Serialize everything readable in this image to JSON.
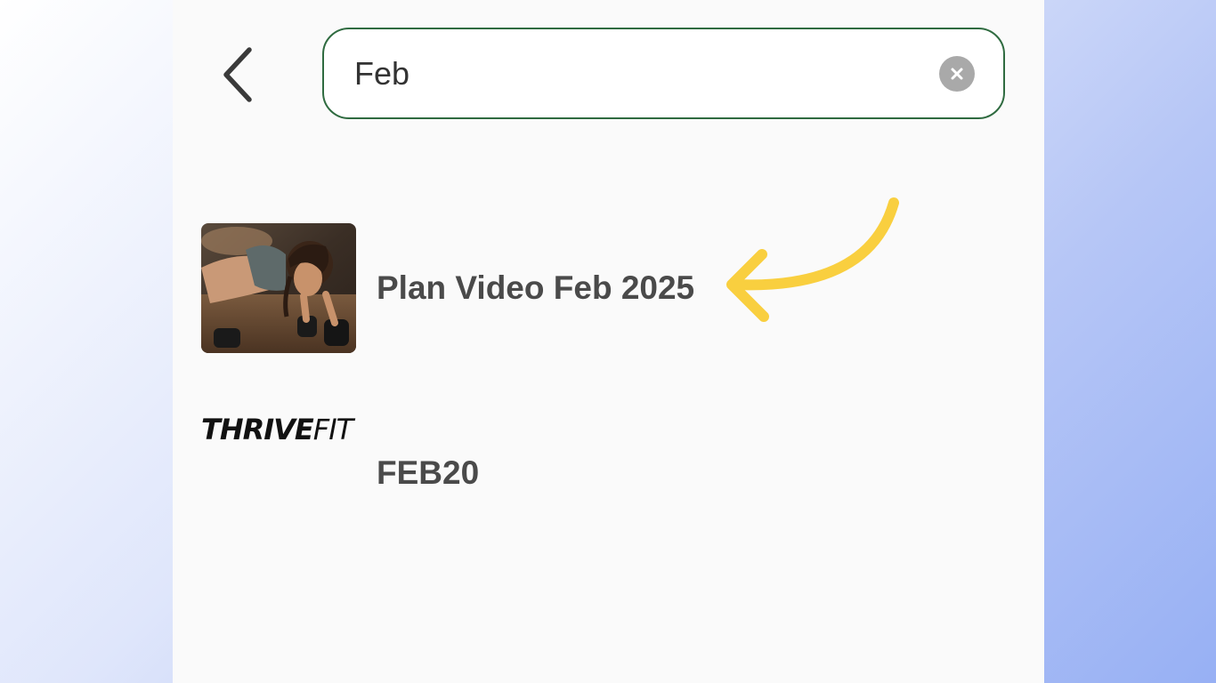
{
  "search": {
    "value": "Feb",
    "placeholder": ""
  },
  "results": [
    {
      "title": "Plan Video Feb 2025",
      "thumbnail": "workout-photo"
    },
    {
      "title": "FEB20",
      "logo": {
        "strong": "THRIVE",
        "light": "FIT"
      }
    }
  ],
  "colors": {
    "search_border": "#2f6b40",
    "arrow": "#f9cf3f",
    "clear_button": "#a9a9a9",
    "text": "#4a4a4a"
  },
  "icons": {
    "back": "chevron-left-icon",
    "clear": "close-circle-icon",
    "annotation": "curved-arrow-icon"
  }
}
